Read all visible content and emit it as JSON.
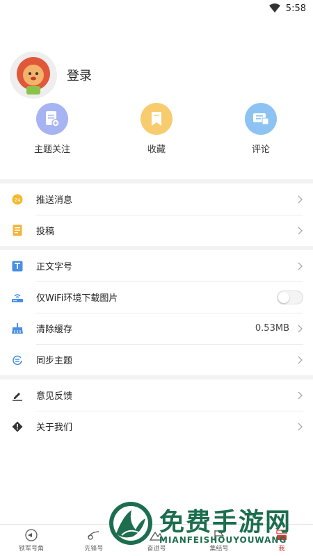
{
  "status_bar": {
    "time": "5:58"
  },
  "profile": {
    "login_label": "登录"
  },
  "quick_actions": [
    {
      "label": "主题关注",
      "color": "#a7b4f3"
    },
    {
      "label": "收藏",
      "color": "#f7cc6f"
    },
    {
      "label": "评论",
      "color": "#8cc3f2"
    }
  ],
  "menu": {
    "push": "推送消息",
    "submit": "投稿",
    "font_size": "正文字号",
    "wifi_images": "仅WiFi环境下载图片",
    "clear_cache": "清除缓存",
    "cache_size": "0.53MB",
    "sync_topics": "同步主题",
    "feedback": "意见反馈",
    "about": "关于我们"
  },
  "tabs": [
    {
      "label": "铁军号角"
    },
    {
      "label": "先锋号"
    },
    {
      "label": "奋进号"
    },
    {
      "label": "集结号"
    },
    {
      "label": "我"
    }
  ],
  "watermark": {
    "title": "免费手游网",
    "subtitle": "MIANFEISHOUYOUWANG"
  },
  "colors": {
    "accent": "#d53b35",
    "watermark": "#1c6e4e"
  }
}
